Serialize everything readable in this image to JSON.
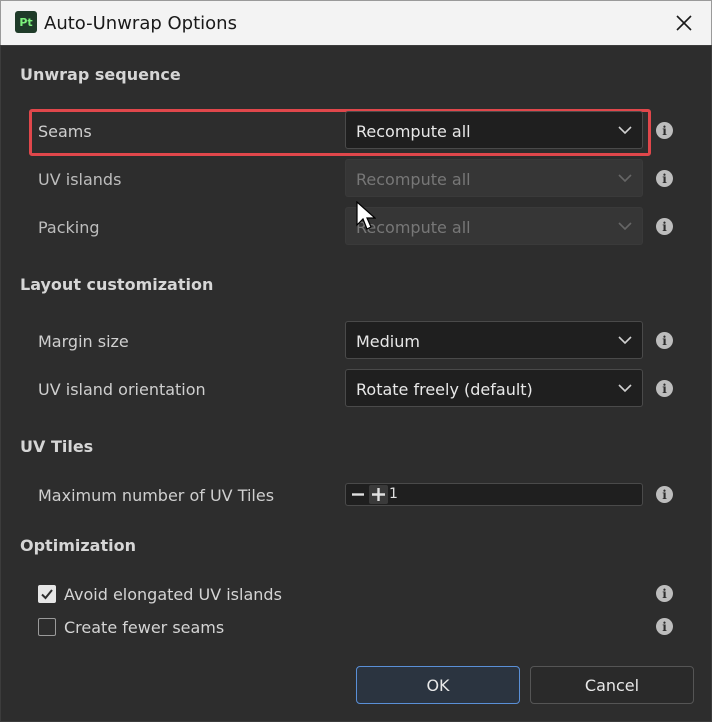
{
  "window": {
    "title": "Auto-Unwrap Options",
    "app_icon_text": "Pt"
  },
  "sections": {
    "unwrap_sequence": {
      "title": "Unwrap sequence",
      "seams": {
        "label": "Seams",
        "value": "Recompute all"
      },
      "uv_islands": {
        "label": "UV islands",
        "value": "Recompute all",
        "disabled": true
      },
      "packing": {
        "label": "Packing",
        "value": "Recompute all",
        "disabled": true
      }
    },
    "layout": {
      "title": "Layout customization",
      "margin": {
        "label": "Margin size",
        "value": "Medium"
      },
      "orientation": {
        "label": "UV island orientation",
        "value": "Rotate freely (default)"
      }
    },
    "uv_tiles": {
      "title": "UV Tiles",
      "max_tiles": {
        "label": "Maximum number of UV Tiles",
        "value": "1"
      }
    },
    "optimization": {
      "title": "Optimization",
      "avoid_elongated": {
        "label": "Avoid elongated UV islands",
        "checked": true
      },
      "fewer_seams": {
        "label": "Create fewer seams",
        "checked": false
      }
    }
  },
  "buttons": {
    "ok": "OK",
    "cancel": "Cancel"
  },
  "colors": {
    "highlight": "#e0474b",
    "accent": "#5a8fd6",
    "background": "#2d2d2d"
  }
}
